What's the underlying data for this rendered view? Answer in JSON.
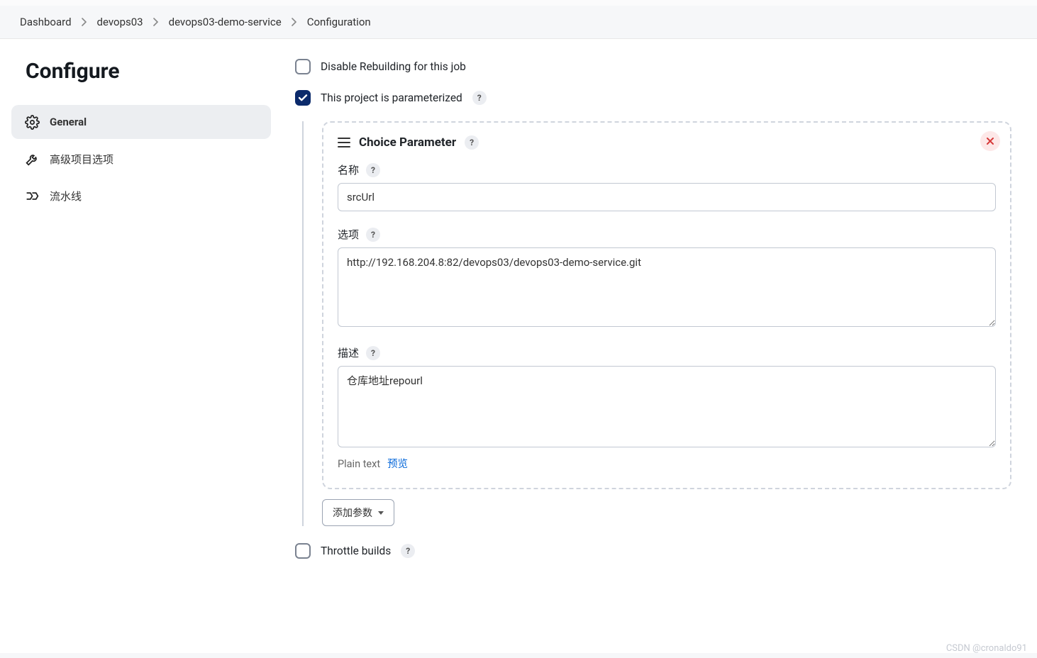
{
  "breadcrumb": {
    "items": [
      "Dashboard",
      "devops03",
      "devops03-demo-service",
      "Configuration"
    ]
  },
  "page_title": "Configure",
  "sidebar": {
    "items": [
      {
        "label": "General",
        "icon": "gear-icon",
        "active": true
      },
      {
        "label": "高级项目选项",
        "icon": "wrench-icon",
        "active": false
      },
      {
        "label": "流水线",
        "icon": "pipeline-icon",
        "active": false
      }
    ]
  },
  "options": {
    "disable_rebuild": {
      "label": "Disable Rebuilding for this job",
      "checked": false
    },
    "parameterized": {
      "label": "This project is parameterized",
      "checked": true
    },
    "throttle": {
      "label": "Throttle builds",
      "checked": false
    }
  },
  "choice_param": {
    "title": "Choice Parameter",
    "name_label": "名称",
    "name_value": "srcUrl",
    "choices_label": "选项",
    "choices_value": "http://192.168.204.8:82/devops03/devops03-demo-service.git",
    "desc_label": "描述",
    "desc_value": "仓库地址repourl",
    "desc_mode": "Plain text",
    "desc_preview": "预览"
  },
  "buttons": {
    "add_param": "添加参数"
  },
  "watermark": "CSDN @cronaldo91"
}
